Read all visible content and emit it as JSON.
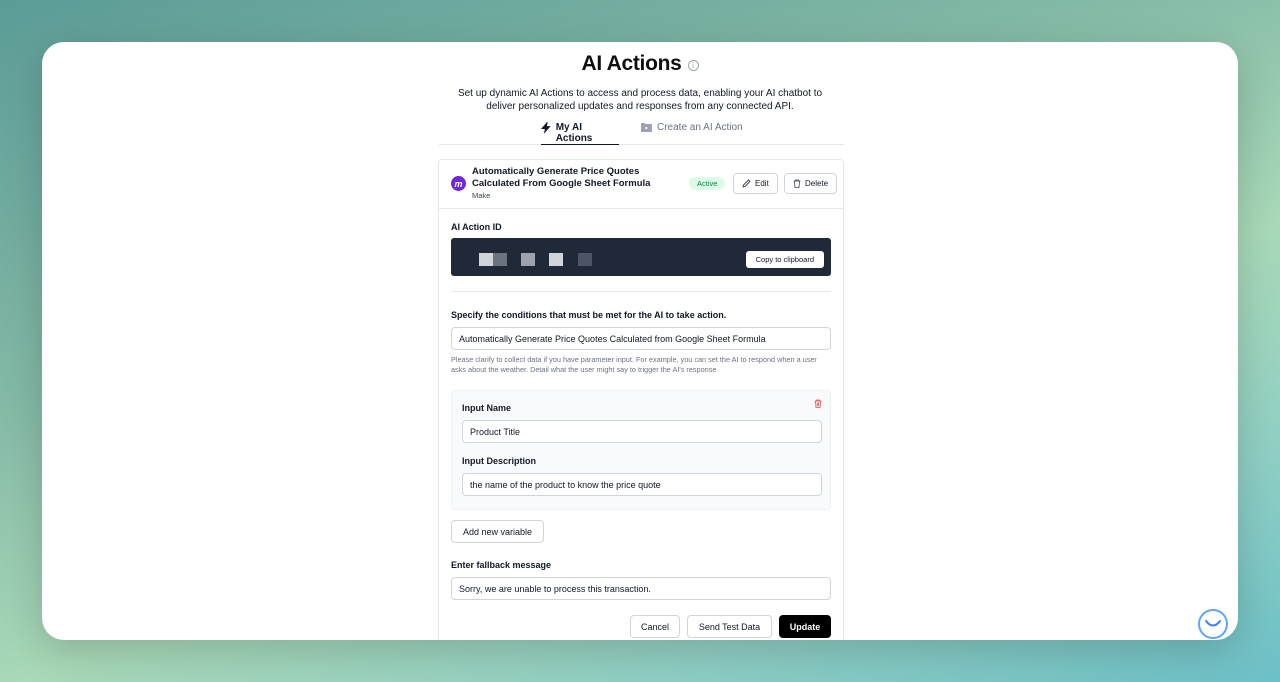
{
  "header": {
    "title": "AI Actions",
    "subtitle": "Set up dynamic AI Actions to access and process data, enabling your AI chatbot to deliver personalized updates and responses from any connected API."
  },
  "tabs": [
    {
      "label": "My AI Actions",
      "icon": "lightning-icon",
      "active": true
    },
    {
      "label": "Create an AI Action",
      "icon": "folder-video-icon",
      "active": false
    }
  ],
  "action": {
    "name": "Automatically Generate Price Quotes Calculated From Google Sheet Formula",
    "provider": "Make",
    "status": "Active",
    "edit_label": "Edit",
    "delete_label": "Delete"
  },
  "ai_action_id": {
    "label": "AI Action ID",
    "copy_label": "Copy to clipboard"
  },
  "conditions": {
    "label": "Specify the conditions that must be met for the AI to take action.",
    "value": "Automatically Generate Price Quotes Calculated from Google Sheet Formula",
    "help": "Please clarify to collect data if you have parameter input. For example, you can set the AI to respond when a user asks about the weather. Detail what the user might say to trigger the AI's response"
  },
  "variable": {
    "name_label": "Input Name",
    "name_value": "Product Title",
    "description_label": "Input Description",
    "description_value": "the name of the product to know the price quote"
  },
  "add_variable_label": "Add new variable",
  "fallback": {
    "label": "Enter fallback message",
    "value": "Sorry, we are unable to process this transaction."
  },
  "footer": {
    "cancel_label": "Cancel",
    "test_label": "Send Test Data",
    "update_label": "Update"
  },
  "colors": {
    "brand_make": "#6d28d9",
    "active_badge_bg": "#dcfce7",
    "active_badge_text": "#15803d",
    "id_bar_bg": "#1f2937",
    "primary_button": "#000000"
  }
}
